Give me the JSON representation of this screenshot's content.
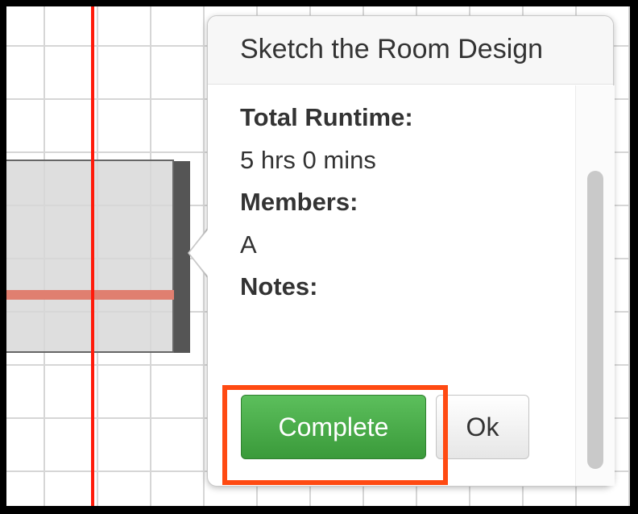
{
  "popover": {
    "title": "Sketch the Room Design",
    "fields": [
      {
        "label": "Total Runtime:",
        "value": "5 hrs 0 mins"
      },
      {
        "label": "Members:",
        "value": "A"
      },
      {
        "label": "Notes:",
        "value": ""
      }
    ],
    "complete_label": "Complete",
    "ok_label": "Ok"
  },
  "colors": {
    "timeline_marker": "#ff1a0a",
    "progress_bar": "#e07f70",
    "complete_button": "#4cae4c",
    "highlight": "#ff4a12"
  }
}
